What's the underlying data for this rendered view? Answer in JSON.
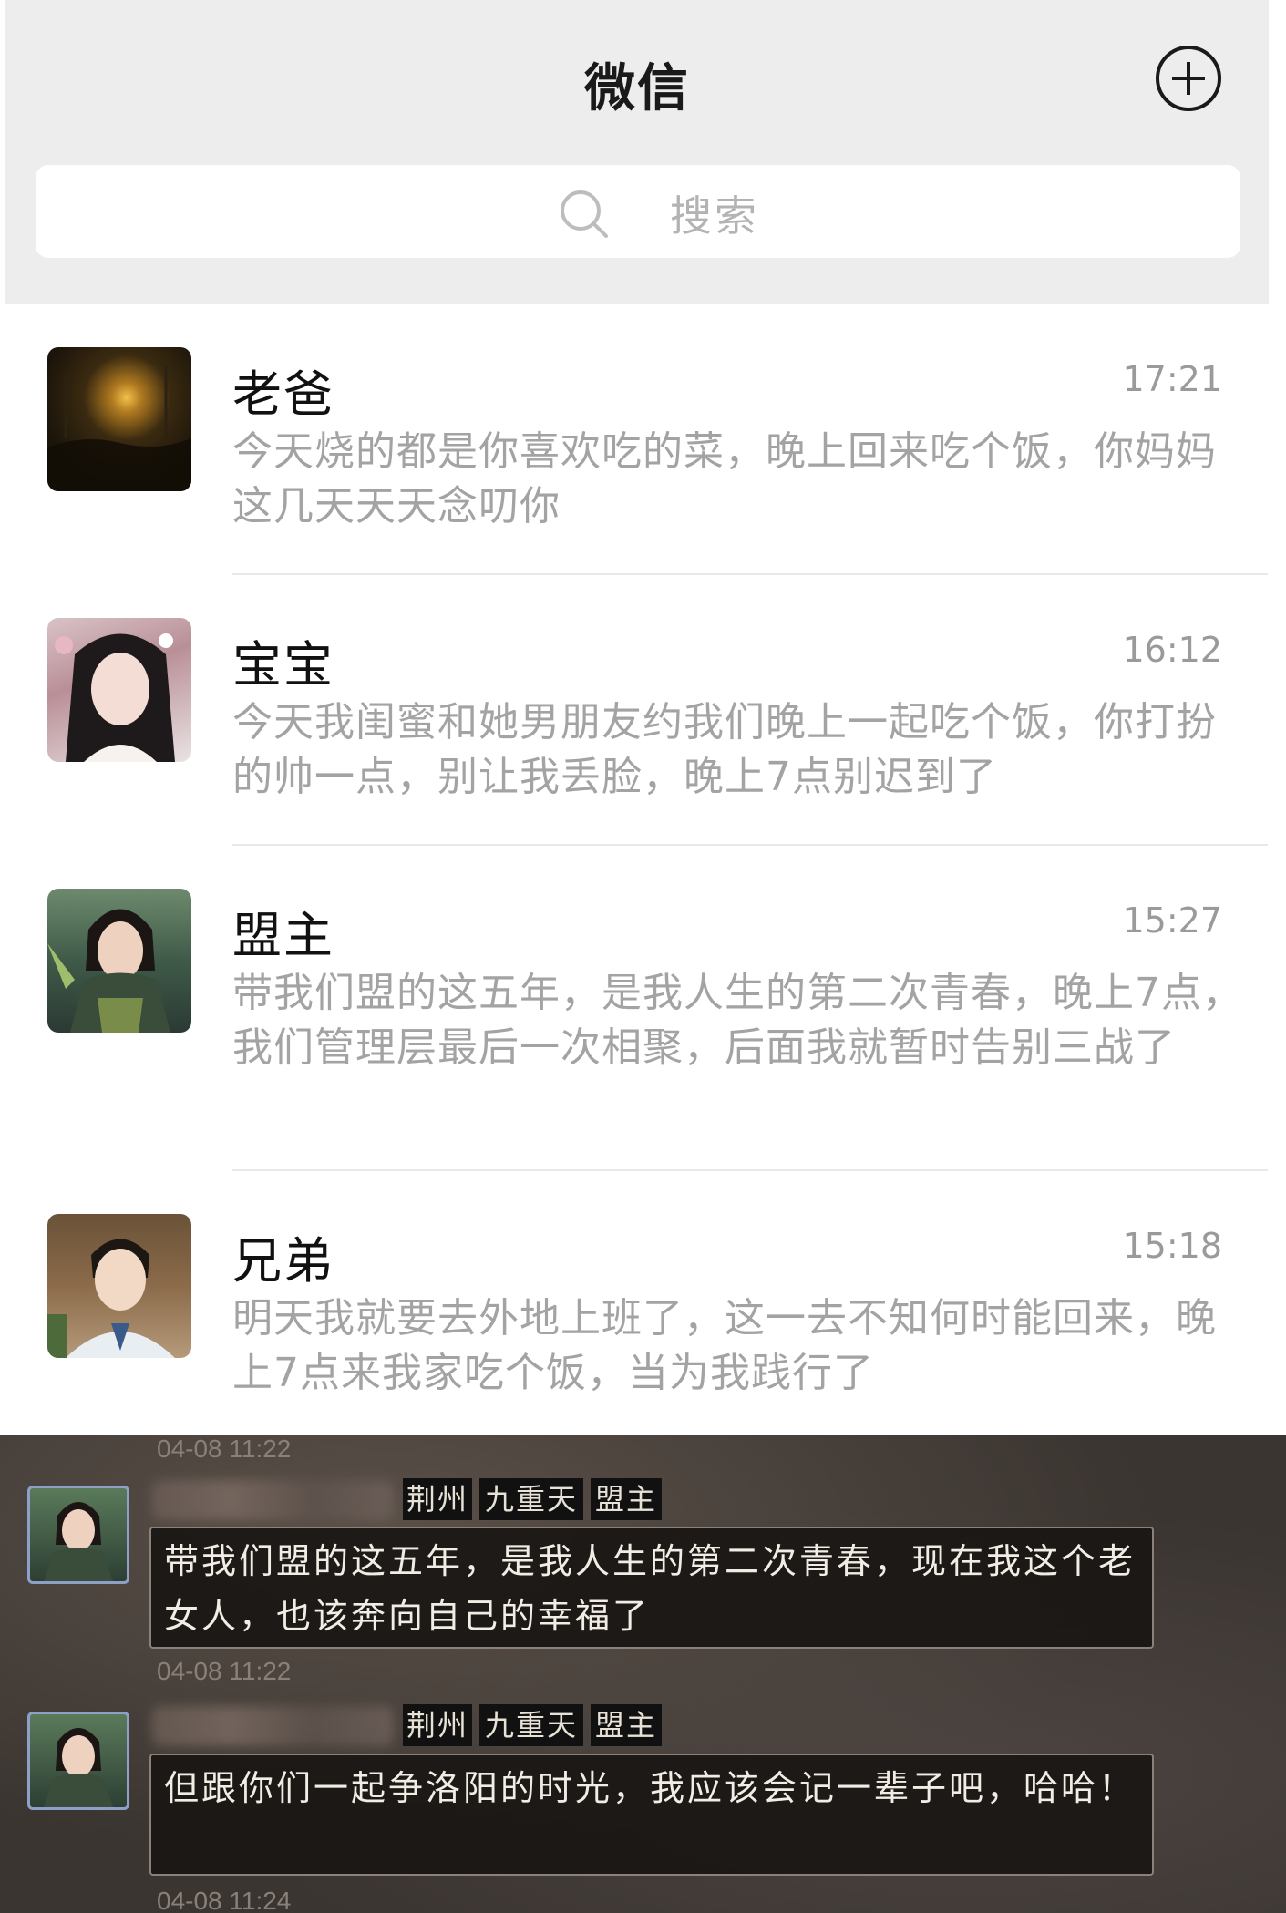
{
  "header": {
    "title": "微信",
    "add_icon": "plus-circle-icon",
    "search_icon": "search-icon",
    "search_placeholder": "搜索",
    "bg_color": "#ededed"
  },
  "chats": [
    {
      "name": "老爸",
      "time": "17:21",
      "preview": "今天烧的都是你喜欢吃的菜，晚上回来吃个饭，你妈妈这几天天天念叨你"
    },
    {
      "name": "宝宝",
      "time": "16:12",
      "preview": "今天我闺蜜和她男朋友约我们晚上一起吃个饭，你打扮的帅一点，别让我丢脸，晚上7点别迟到了"
    },
    {
      "name": "盟主",
      "time": "15:27",
      "preview": "带我们盟的这五年，是我人生的第二次青春，晚上7点，我们管理层最后一次相聚，后面我就暂时告别三战了"
    },
    {
      "name": "兄弟",
      "time": "15:18",
      "preview": "明天我就要去外地上班了，这一去不知何时能回来，晚上7点来我家吃个饭，当为我践行了"
    }
  ],
  "game_chat": {
    "messages": [
      {
        "time": "04-08 11:22",
        "tags": [
          "荆州",
          "九重天",
          "盟主"
        ],
        "text": "带我们盟的这五年，是我人生的第二次青春，现在我这个老女人，也该奔向自己的幸福了"
      },
      {
        "time": "04-08 11:22",
        "tags": [
          "荆州",
          "九重天",
          "盟主"
        ],
        "text": "但跟你们一起争洛阳的时光，我应该会记一辈子吧，哈哈！"
      }
    ],
    "trailing_time": "04-08 11:24"
  }
}
